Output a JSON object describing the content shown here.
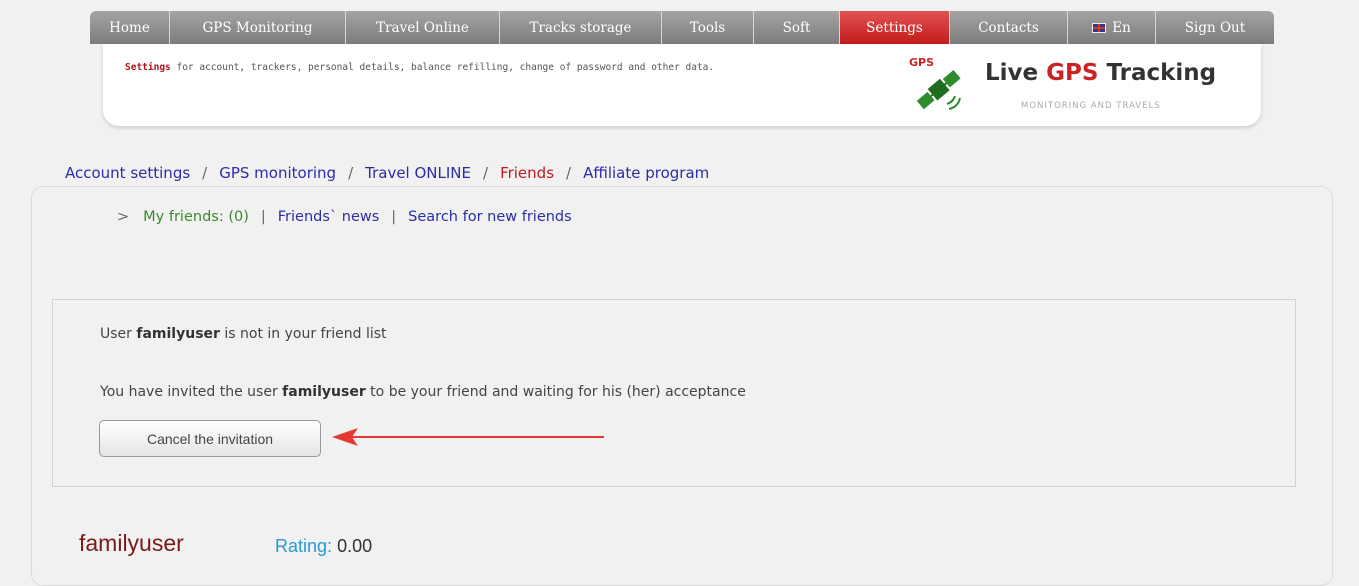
{
  "nav": {
    "items": [
      {
        "label": "Home",
        "width": 80
      },
      {
        "label": "GPS Monitoring",
        "width": 176
      },
      {
        "label": "Travel Online",
        "width": 154
      },
      {
        "label": "Tracks storage",
        "width": 162
      },
      {
        "label": "Tools",
        "width": 92
      },
      {
        "label": "Soft",
        "width": 86
      },
      {
        "label": "Settings",
        "width": 110,
        "active": true
      },
      {
        "label": "Contacts",
        "width": 118
      },
      {
        "label": "En",
        "width": 88,
        "flag": true
      },
      {
        "label": "Sign Out",
        "width": 118
      }
    ]
  },
  "banner": {
    "desc_bold": "Settings",
    "desc_text": " for account, trackers, personal details, balance refilling, change of password and other data.",
    "logo_small": "GPS",
    "logo_title_1": "Live ",
    "logo_title_red": "GPS",
    "logo_title_2": " Tracking",
    "logo_sub": "MONITORING AND TRAVELS"
  },
  "tabs": {
    "account": "Account settings",
    "gps": "GPS monitoring",
    "travel": "Travel ONLINE",
    "friends": "Friends",
    "affiliate": "Affiliate program",
    "separator": "/"
  },
  "subnav": {
    "arrow": ">",
    "my_friends": "My friends: (0)",
    "news": "Friends` news",
    "search": "Search for new friends",
    "pipe": "|"
  },
  "info": {
    "line1_pre": "User ",
    "line1_user": "familyuser",
    "line1_post": " is not in your friend list",
    "line2_pre": "You have invited the user ",
    "line2_user": "familyuser",
    "line2_post": " to be your friend and waiting for his (her) acceptance",
    "cancel_label": "Cancel the invitation"
  },
  "profile": {
    "name": "familyuser",
    "rating_label": "Rating:",
    "rating_value": "0.00"
  },
  "colors": {
    "accent_red": "#c21b1b",
    "link_blue": "#2c2ca6",
    "active_green": "#3a8a2a",
    "rating_blue": "#2a9ad0",
    "arrow_red": "#e53935"
  }
}
